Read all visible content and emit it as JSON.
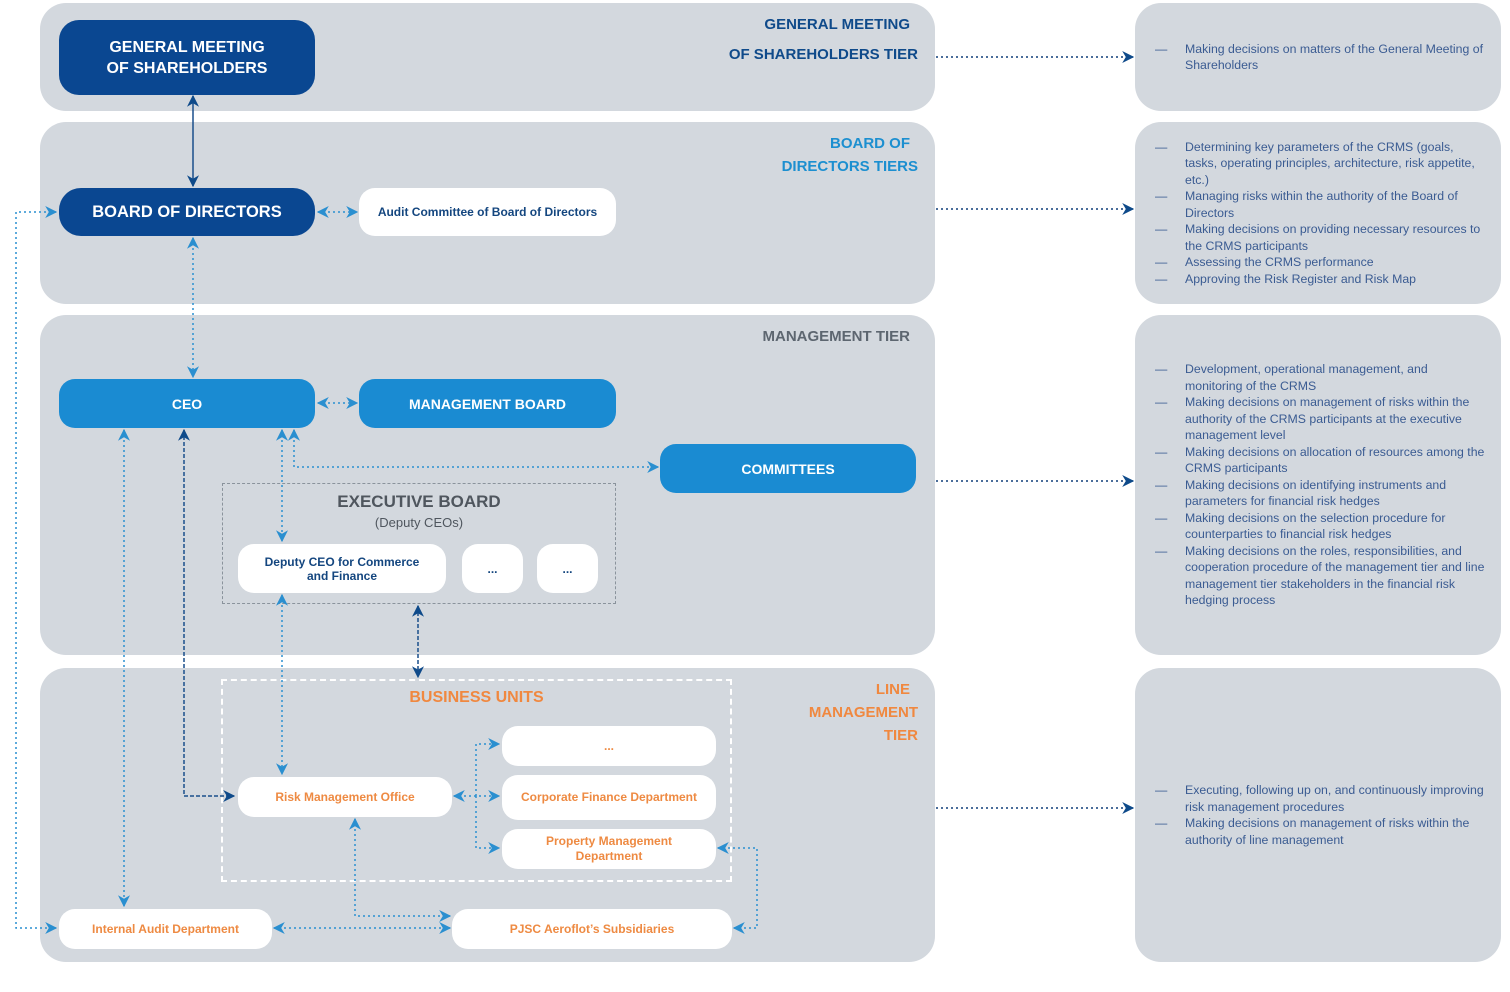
{
  "tiers": {
    "gms": {
      "label_line1": "GENERAL MEETING",
      "label_line2": "OF SHAREHOLDERS TIER"
    },
    "bod": {
      "label_line1": "BOARD OF",
      "label_line2": "DIRECTORS TIERS"
    },
    "mgmt": {
      "label_line1": "MANAGEMENT TIER"
    },
    "line": {
      "label_line1": "LINE",
      "label_line2": "MANAGEMENT",
      "label_line3": "TIER"
    }
  },
  "nodes": {
    "gms": {
      "line1": "GENERAL MEETING",
      "line2": "OF SHAREHOLDERS"
    },
    "bod": "BOARD OF DIRECTORS",
    "audit_committee": "Audit Committee of Board of Directors",
    "ceo": "CEO",
    "management_board": "MANAGEMENT BOARD",
    "committees": "COMMITTEES",
    "executive_board": {
      "title": "EXECUTIVE BOARD",
      "subtitle": "(Deputy CEOs)"
    },
    "deputy_ceo": {
      "line1": "Deputy CEO for Commerce",
      "line2": "and Finance"
    },
    "deputy_more_1": "...",
    "deputy_more_2": "...",
    "business_units": "BUSINESS UNITS",
    "bu_more": "...",
    "risk_office": "Risk Management Office",
    "corp_finance": "Corporate Finance Department",
    "property_mgmt": {
      "line1": "Property Management",
      "line2": "Department"
    },
    "internal_audit": "Internal Audit Department",
    "subsidiaries": "PJSC Aeroflot’s Subsidiaries"
  },
  "descriptions": {
    "gms": [
      "Making decisions on matters of the General Meeting of Shareholders"
    ],
    "bod": [
      "Determining key parameters of the CRMS (goals, tasks, operating principles, architecture, risk appetite, etc.)",
      "Managing risks within the authority of the Board of Directors",
      "Making decisions on providing necessary resources to the CRMS participants",
      "Assessing the CRMS performance",
      "Approving the Risk Register and Risk Map"
    ],
    "mgmt": [
      "Development, operational management, and monitoring of the CRMS",
      "Making decisions on management of risks within the authority of the CRMS participants at the executive management level",
      "Making decisions on allocation of resources among the CRMS participants",
      "Making decisions on identifying instruments and parameters for financial risk hedges",
      "Making decisions on the selection procedure for counterparties to financial risk hedges",
      "Making decisions on the roles, responsibilities, and cooperation procedure of the management tier and line management tier stakeholders in the financial risk hedging process"
    ],
    "line": [
      "Executing, following up on, and continuously improving risk management procedures",
      "Making decisions on management of risks within the authority of line management"
    ]
  },
  "colors": {
    "navy": "#0a4791",
    "blue": "#1a8bd2",
    "orange": "#f0883f",
    "panel": "#d3d8de"
  }
}
